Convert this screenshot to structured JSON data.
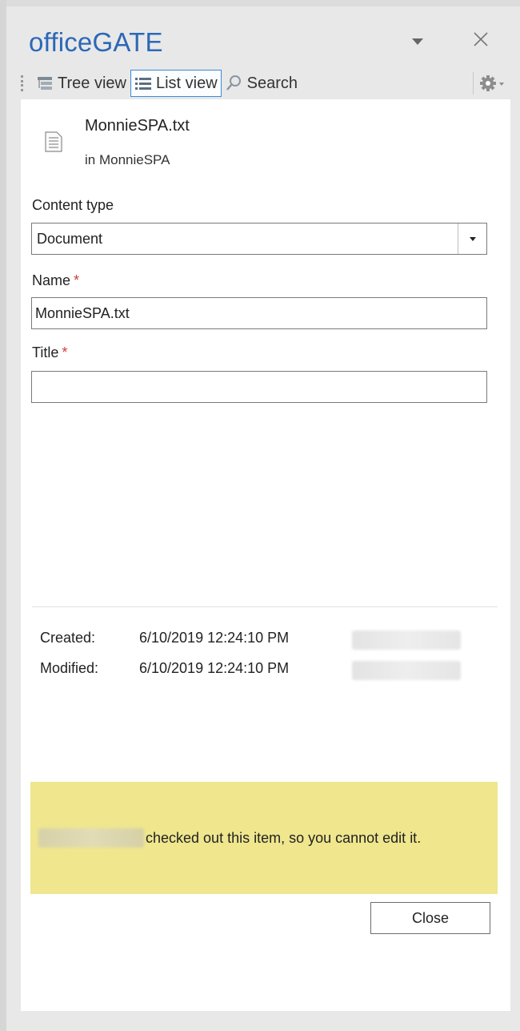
{
  "app": {
    "title": "officeGATE",
    "menu_icon": "triangle-down-icon",
    "close_icon": "close-x-icon"
  },
  "toolbar": {
    "tabs": [
      {
        "label": "Tree view",
        "icon": "tree-view-icon",
        "active": false
      },
      {
        "label": "List view",
        "icon": "list-view-icon",
        "active": true
      },
      {
        "label": "Search",
        "icon": "search-icon",
        "active": false
      }
    ],
    "settings_icon": "gear-icon"
  },
  "item": {
    "icon": "text-document-icon",
    "name": "MonnieSPA.txt",
    "location": "in MonnieSPA"
  },
  "form": {
    "content_type": {
      "label": "Content type",
      "value": "Document"
    },
    "name": {
      "label": "Name",
      "required_mark": "*",
      "value": "MonnieSPA.txt"
    },
    "title": {
      "label": "Title",
      "required_mark": "*",
      "value": ""
    }
  },
  "metadata": {
    "created": {
      "label": "Created:",
      "value": "6/10/2019 12:24:10 PM"
    },
    "modified": {
      "label": "Modified:",
      "value": "6/10/2019 12:24:10 PM"
    }
  },
  "notice": {
    "message": "checked out this item, so you cannot edit it.",
    "background": "#efe68e"
  },
  "buttons": {
    "close": "Close"
  },
  "colors": {
    "title": "#2b68b7",
    "active_tab_border": "#3c8ad8",
    "required": "#d23c3c"
  }
}
